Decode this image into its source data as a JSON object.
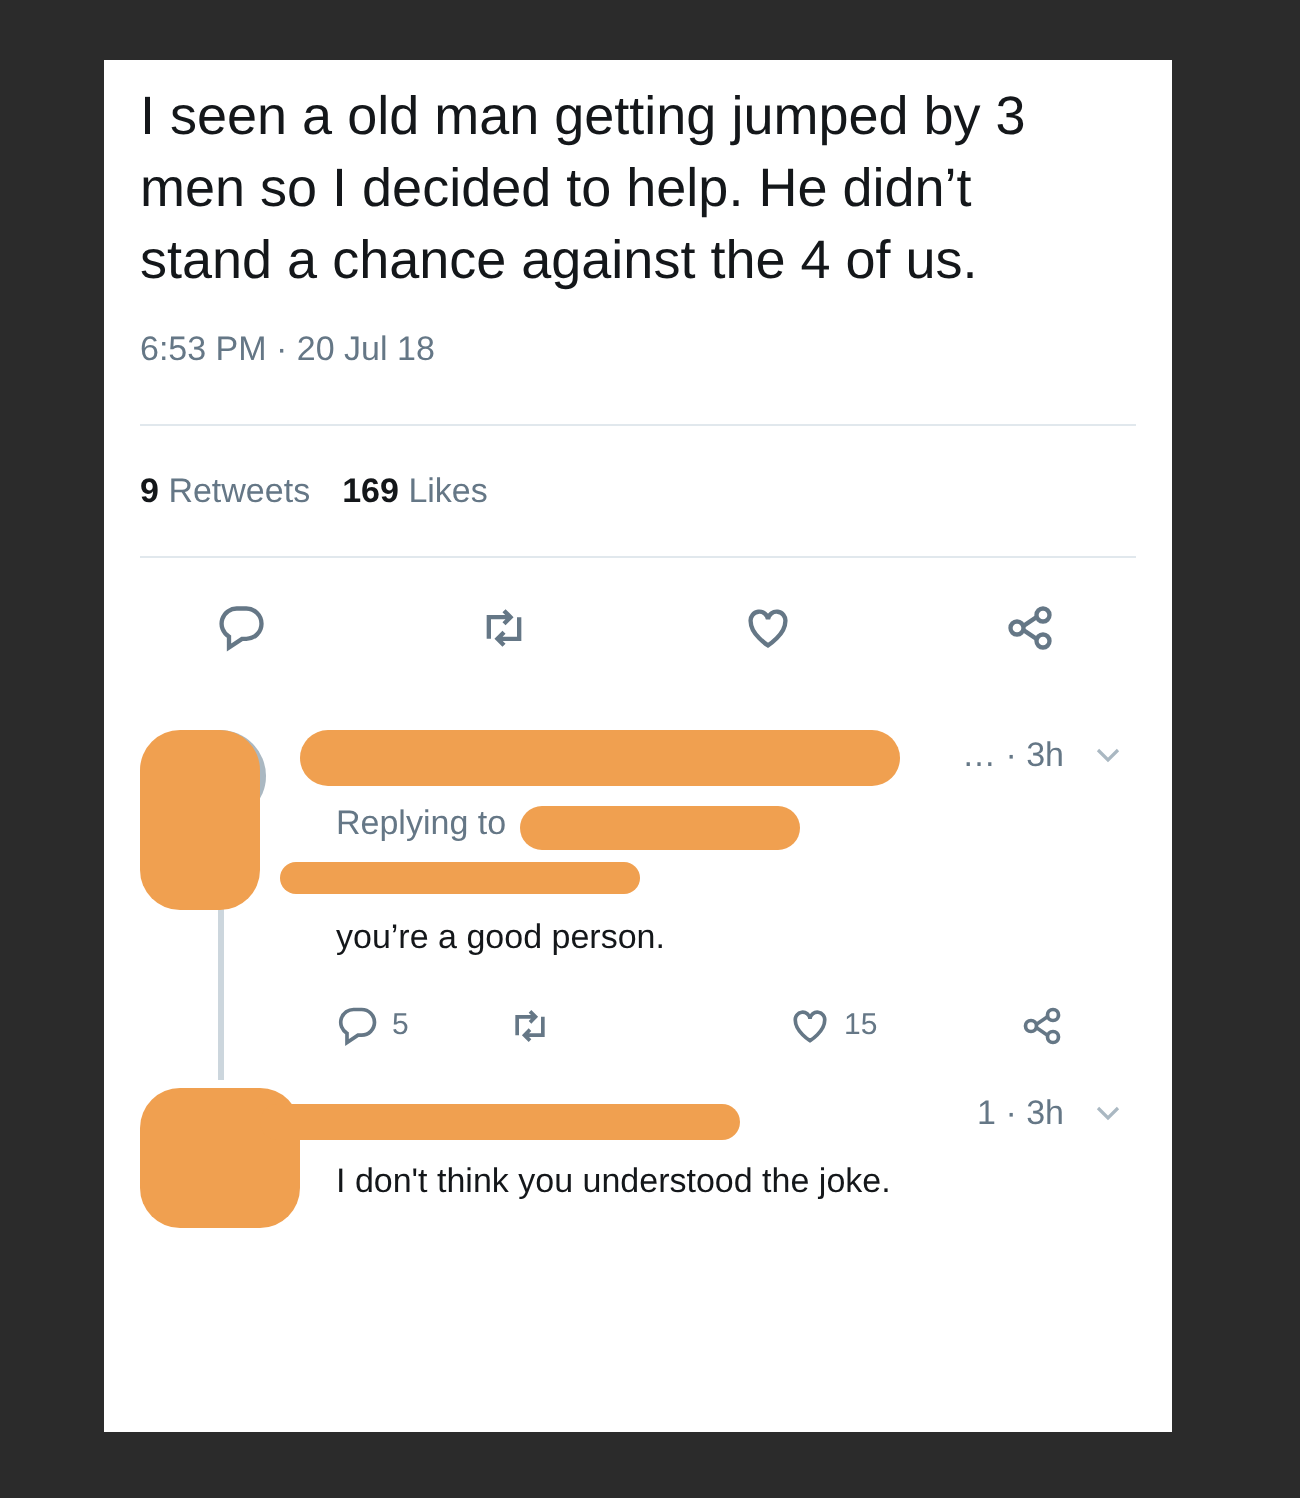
{
  "tweet": {
    "text": "I seen a old man getting jumped by 3 men so I decided to help. He didn’t stand a chance against the 4 of us.",
    "timestamp": "6:53 PM · 20 Jul 18",
    "stats": [
      {
        "count": "9",
        "label": "Retweets"
      },
      {
        "count": "169",
        "label": "Likes"
      }
    ],
    "actions": [
      {
        "kind": "reply"
      },
      {
        "kind": "retweet"
      },
      {
        "kind": "like"
      },
      {
        "kind": "share"
      }
    ]
  },
  "replies": [
    {
      "meta": "… · 3h",
      "replying_to": "Replying to",
      "text": "you’re a good person.",
      "actions": [
        {
          "kind": "reply",
          "count": "5"
        },
        {
          "kind": "retweet"
        },
        {
          "kind": "like",
          "count": "15"
        },
        {
          "kind": "share"
        }
      ]
    },
    {
      "meta": "1 · 3h",
      "text": "I don't think you understood the joke."
    }
  ]
}
